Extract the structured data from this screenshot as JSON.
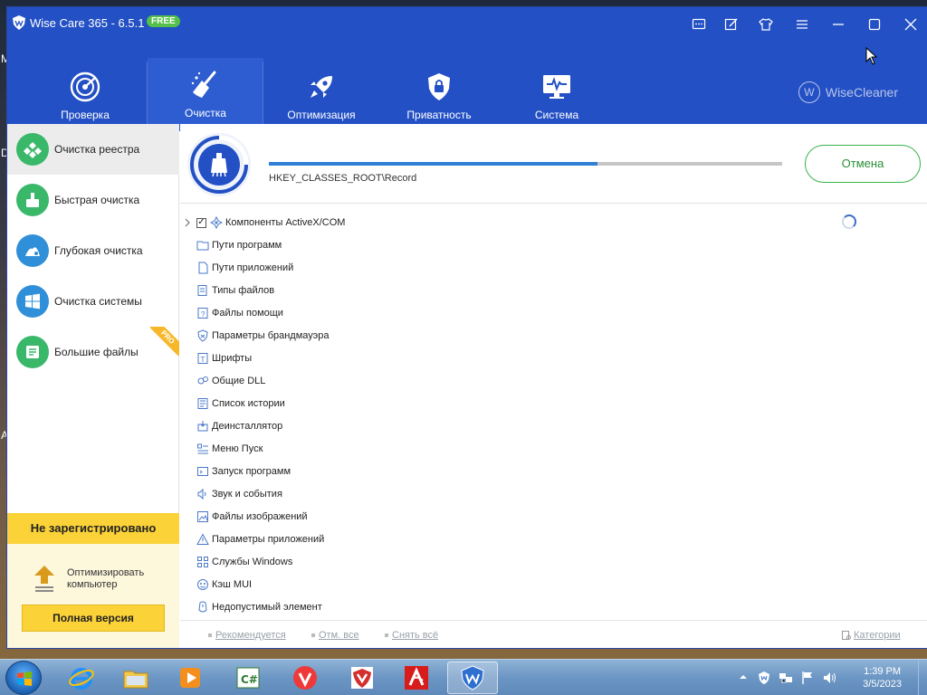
{
  "desktop": {
    "fragments": [
      "M",
      "D",
      "A"
    ]
  },
  "window": {
    "title": "Wise Care 365 - 6.5.1",
    "edition_badge": "FREE",
    "controls": [
      "feedback",
      "edit",
      "skin",
      "menu",
      "minimize",
      "maximize",
      "close"
    ]
  },
  "nav": {
    "tabs": [
      {
        "label": "Проверка",
        "icon": "radar-icon"
      },
      {
        "label": "Очистка",
        "icon": "broom-icon",
        "active": true
      },
      {
        "label": "Оптимизация",
        "icon": "rocket-icon"
      },
      {
        "label": "Приватность",
        "icon": "shield-lock-icon"
      },
      {
        "label": "Система",
        "icon": "monitor-pulse-icon"
      }
    ],
    "brand": "WiseCleaner",
    "brand_mark": "W"
  },
  "sidebar": {
    "items": [
      {
        "label": "Очистка реестра",
        "color": "#39b86a",
        "active": true
      },
      {
        "label": "Быстрая очистка",
        "color": "#39b86a"
      },
      {
        "label": "Глубокая очистка",
        "color": "#2f8fd8"
      },
      {
        "label": "Очистка системы",
        "color": "#2f8fd8"
      },
      {
        "label": "Большие файлы",
        "color": "#39b86a",
        "pro": "PRO"
      }
    ],
    "registration": {
      "status": "Не зарегистрировано",
      "promo": "Оптимизировать компьютер",
      "button": "Полная версия"
    }
  },
  "scan": {
    "progress": 0.64,
    "current_path": "HKEY_CLASSES_ROOT\\Record",
    "cancel_label": "Отмена"
  },
  "categories": [
    {
      "label": "Компоненты ActiveX/COM",
      "checked": true,
      "expandable": true,
      "icon": "activex-icon",
      "scanning": true
    },
    {
      "label": "Пути программ",
      "icon": "folder-icon"
    },
    {
      "label": "Пути приложений",
      "icon": "file-icon"
    },
    {
      "label": "Типы файлов",
      "icon": "filetypes-icon"
    },
    {
      "label": "Файлы помощи",
      "icon": "help-file-icon"
    },
    {
      "label": "Параметры брандмауэра",
      "icon": "firewall-icon"
    },
    {
      "label": "Шрифты",
      "icon": "font-icon"
    },
    {
      "label": "Общие DLL",
      "icon": "dll-icon"
    },
    {
      "label": "Список истории",
      "icon": "history-icon"
    },
    {
      "label": "Деинсталлятор",
      "icon": "uninstaller-icon"
    },
    {
      "label": "Меню Пуск",
      "icon": "start-menu-icon"
    },
    {
      "label": "Запуск программ",
      "icon": "startup-icon"
    },
    {
      "label": "Звук и события",
      "icon": "sound-icon"
    },
    {
      "label": "Файлы изображений",
      "icon": "image-file-icon"
    },
    {
      "label": "Параметры приложений",
      "icon": "app-settings-icon"
    },
    {
      "label": "Службы Windows",
      "icon": "services-icon"
    },
    {
      "label": "Кэш MUI",
      "icon": "mui-cache-icon"
    },
    {
      "label": "Недопустимый элемент",
      "icon": "invalid-item-icon"
    }
  ],
  "footer": {
    "recommended": "Рекомендуется",
    "check_all": "Отм. все",
    "uncheck_all": "Снять всё",
    "categories": "Категории"
  },
  "taskbar": {
    "apps": [
      "internet-explorer",
      "file-explorer",
      "media-player",
      "csharp-editor",
      "vivaldi",
      "antivirus-shield",
      "avira",
      "wise-care"
    ],
    "time": "1:39 PM",
    "date": "3/5/2023"
  },
  "colors": {
    "brand_blue": "#2350c4",
    "accent_green": "#3ab34a",
    "promo_yellow": "#fbd237",
    "progress_blue": "#2f7fd5"
  }
}
